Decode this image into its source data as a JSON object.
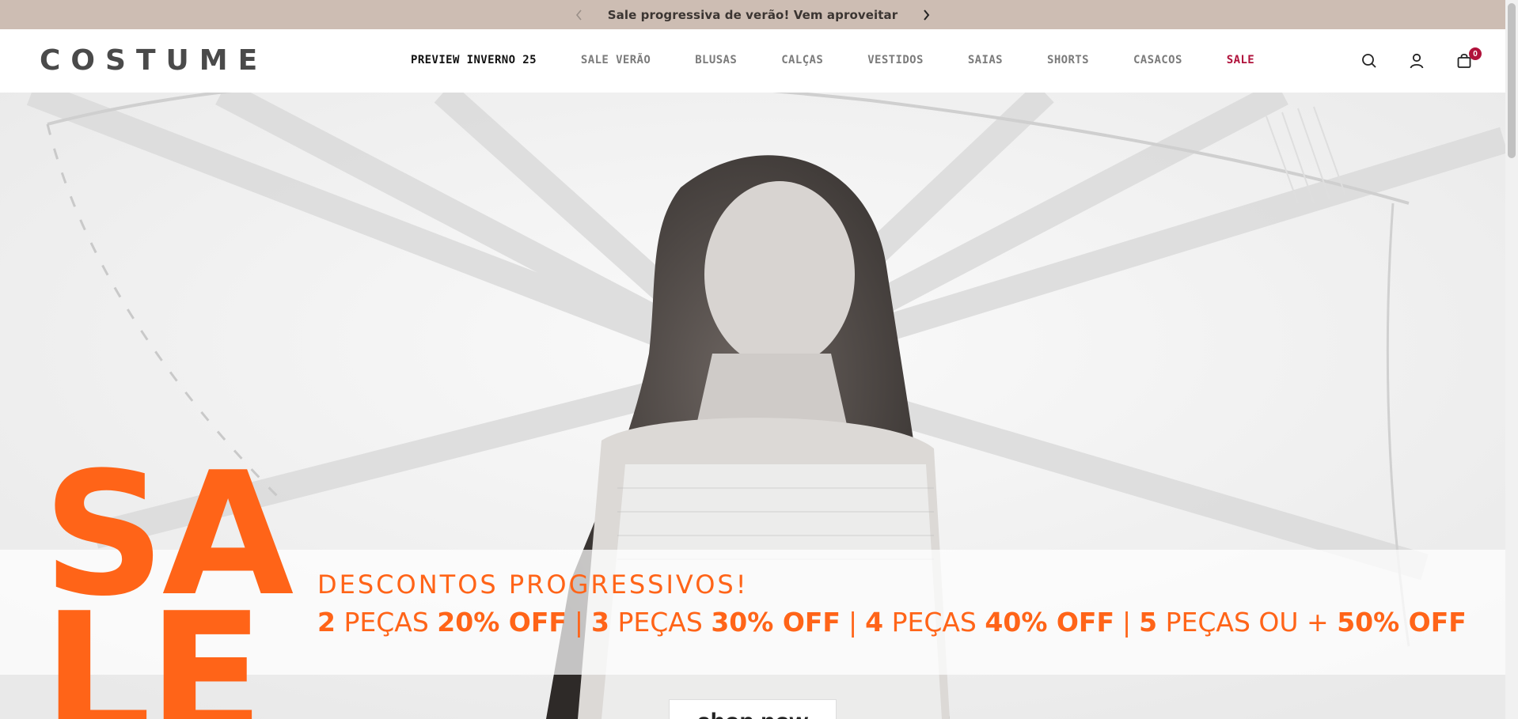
{
  "announcement": {
    "text": "Sale progressiva de verão! Vem aproveitar",
    "prev_icon": "chevron-left-icon",
    "next_icon": "chevron-right-icon"
  },
  "header": {
    "logo": "COSTUME",
    "nav": [
      {
        "label": "PREVIEW INVERNO 25",
        "state": "active"
      },
      {
        "label": "SALE VERÃO"
      },
      {
        "label": "BLUSAS"
      },
      {
        "label": "CALÇAS"
      },
      {
        "label": "VESTIDOS"
      },
      {
        "label": "SAIAS"
      },
      {
        "label": "SHORTS"
      },
      {
        "label": "CASACOS"
      },
      {
        "label": "SALE",
        "state": "highlight"
      }
    ],
    "icons": [
      "search-icon",
      "user-icon",
      "cart-icon"
    ],
    "cart_count": "0"
  },
  "hero": {
    "sale_line1": "SA",
    "sale_line2": "LE",
    "promo_title": "DESCONTOS PROGRESSIVOS!",
    "offers": [
      {
        "num": "2",
        "unit": "PEÇAS",
        "discount": "20% OFF"
      },
      {
        "num": "3",
        "unit": "PEÇAS",
        "discount": "30% OFF"
      },
      {
        "num": "4",
        "unit": "PEÇAS",
        "discount": "40% OFF"
      },
      {
        "num": "5",
        "unit": "PEÇAS OU +",
        "discount": "50% OFF"
      }
    ],
    "separator": "|",
    "cta": "shop now"
  },
  "colors": {
    "announcement_bg": "#cdbdb3",
    "accent_orange": "#ff6418",
    "sale_red": "#b0123b"
  }
}
